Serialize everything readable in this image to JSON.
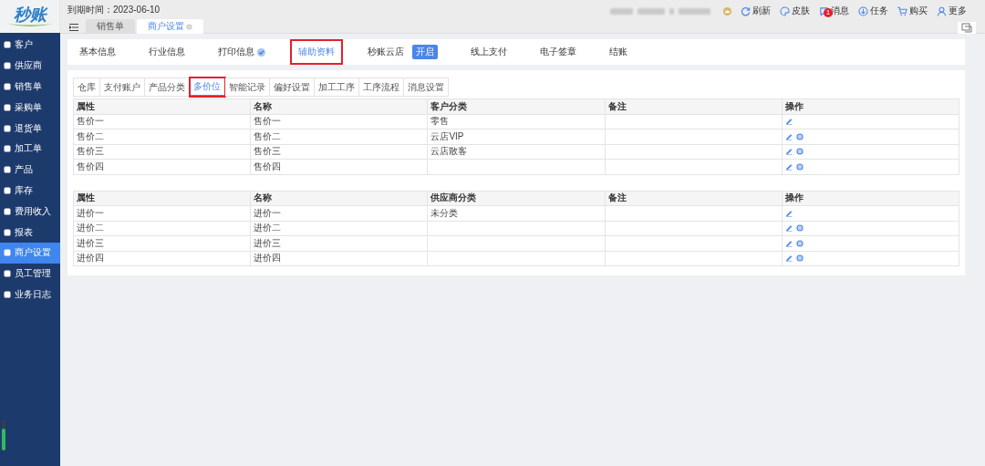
{
  "header": {
    "logo": "秒账",
    "expiry": "到期时间：2023-06-10",
    "tabs": [
      {
        "label": "销售单",
        "selected": false,
        "closable": false
      },
      {
        "label": "商户设置",
        "selected": true,
        "closable": true
      }
    ],
    "actions": [
      {
        "label": "刷新",
        "kind": "refresh"
      },
      {
        "label": "皮肤",
        "kind": "skin"
      },
      {
        "label": "消息",
        "kind": "message",
        "badge": "1"
      },
      {
        "label": "任务",
        "kind": "task"
      },
      {
        "label": "购买",
        "kind": "cart"
      },
      {
        "label": "更多",
        "kind": "user"
      }
    ]
  },
  "sidebar": {
    "items": [
      {
        "label": "客户",
        "selected": false
      },
      {
        "label": "供应商",
        "selected": false
      },
      {
        "label": "销售单",
        "selected": false
      },
      {
        "label": "采购单",
        "selected": false
      },
      {
        "label": "退货单",
        "selected": false
      },
      {
        "label": "加工单",
        "selected": false
      },
      {
        "label": "产品",
        "selected": false
      },
      {
        "label": "库存",
        "selected": false
      },
      {
        "label": "费用收入",
        "selected": false
      },
      {
        "label": "报表",
        "selected": false
      },
      {
        "label": "商户设置",
        "selected": true
      },
      {
        "label": "员工管理",
        "selected": false
      },
      {
        "label": "业务日志",
        "selected": false
      }
    ]
  },
  "settings_tabs": [
    {
      "label": "基本信息",
      "selected": false
    },
    {
      "label": "行业信息",
      "selected": false
    },
    {
      "label": "打印信息",
      "selected": false,
      "verified": true
    },
    {
      "label": "辅助资料",
      "selected": true
    },
    {
      "label": "秒账云店",
      "selected": false,
      "badge": "开启"
    },
    {
      "label": "线上支付",
      "selected": false
    },
    {
      "label": "电子签章",
      "selected": false
    },
    {
      "label": "结账",
      "selected": false
    }
  ],
  "sub_tabs": [
    {
      "label": "仓库",
      "selected": false
    },
    {
      "label": "支付账户",
      "selected": false
    },
    {
      "label": "产品分类",
      "selected": false
    },
    {
      "label": "多价位",
      "selected": true
    },
    {
      "label": "智能记录",
      "selected": false
    },
    {
      "label": "偏好设置",
      "selected": false
    },
    {
      "label": "加工工序",
      "selected": false
    },
    {
      "label": "工序流程",
      "selected": false
    },
    {
      "label": "消息设置",
      "selected": false
    }
  ],
  "tables": [
    {
      "columns": [
        "属性",
        "名称",
        "客户分类",
        "备注",
        "操作"
      ],
      "rows": [
        {
          "cells": [
            "售价一",
            "售价一",
            "零售",
            ""
          ],
          "deletable": false
        },
        {
          "cells": [
            "售价二",
            "售价二",
            "云店VIP",
            ""
          ],
          "deletable": true
        },
        {
          "cells": [
            "售价三",
            "售价三",
            "云店散客",
            ""
          ],
          "deletable": true
        },
        {
          "cells": [
            "售价四",
            "售价四",
            "",
            ""
          ],
          "deletable": true
        }
      ]
    },
    {
      "columns": [
        "属性",
        "名称",
        "供应商分类",
        "备注",
        "操作"
      ],
      "rows": [
        {
          "cells": [
            "进价一",
            "进价一",
            "未分类",
            ""
          ],
          "deletable": false
        },
        {
          "cells": [
            "进价二",
            "进价二",
            "",
            ""
          ],
          "deletable": true
        },
        {
          "cells": [
            "进价三",
            "进价三",
            "",
            ""
          ],
          "deletable": true
        },
        {
          "cells": [
            "进价四",
            "进价四",
            "",
            ""
          ],
          "deletable": true
        }
      ]
    }
  ]
}
